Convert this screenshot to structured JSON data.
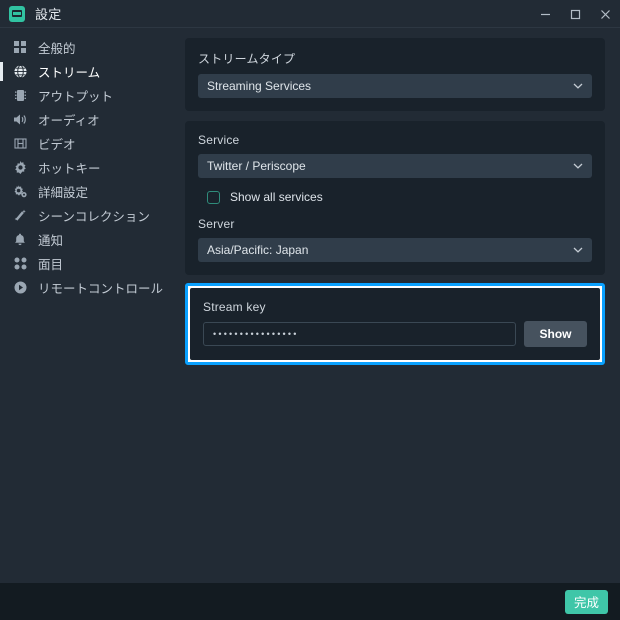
{
  "window": {
    "title": "設定",
    "app_icon": "obs-app-icon",
    "controls": [
      {
        "name": "minimize-button",
        "icon": "minimize-icon"
      },
      {
        "name": "maximize-button",
        "icon": "maximize-icon"
      },
      {
        "name": "close-button",
        "icon": "close-icon"
      }
    ]
  },
  "sidebar": {
    "items": [
      {
        "label": "全般的",
        "icon": "grid-icon",
        "active": false
      },
      {
        "label": "ストリーム",
        "icon": "globe-icon",
        "active": true
      },
      {
        "label": "アウトプット",
        "icon": "chip-icon",
        "active": false
      },
      {
        "label": "オーディオ",
        "icon": "speaker-icon",
        "active": false
      },
      {
        "label": "ビデオ",
        "icon": "film-icon",
        "active": false
      },
      {
        "label": "ホットキー",
        "icon": "gear-icon",
        "active": false
      },
      {
        "label": "詳細設定",
        "icon": "gears-icon",
        "active": false
      },
      {
        "label": "シーンコレクション",
        "icon": "magic-wand-icon",
        "active": false
      },
      {
        "label": "通知",
        "icon": "bell-icon",
        "active": false
      },
      {
        "label": "面目",
        "icon": "dots-grid-icon",
        "active": false
      },
      {
        "label": "リモートコントロール",
        "icon": "play-circle-icon",
        "active": false
      }
    ]
  },
  "main": {
    "stream_type": {
      "label": "ストリームタイプ",
      "value": "Streaming Services",
      "chevron": "chevron-down-icon"
    },
    "service": {
      "label": "Service",
      "value": "Twitter / Periscope",
      "chevron": "chevron-down-icon"
    },
    "show_all_services": {
      "label": "Show all services",
      "checked": false
    },
    "server": {
      "label": "Server",
      "value": "Asia/Pacific: Japan",
      "chevron": "chevron-down-icon"
    },
    "stream_key": {
      "label": "Stream key",
      "value": "••••••••••••••••",
      "show_button": "Show",
      "highlight_color": "#0aa1ff"
    }
  },
  "footer": {
    "done_label": "完成",
    "accent_color": "#3fc6a8"
  }
}
